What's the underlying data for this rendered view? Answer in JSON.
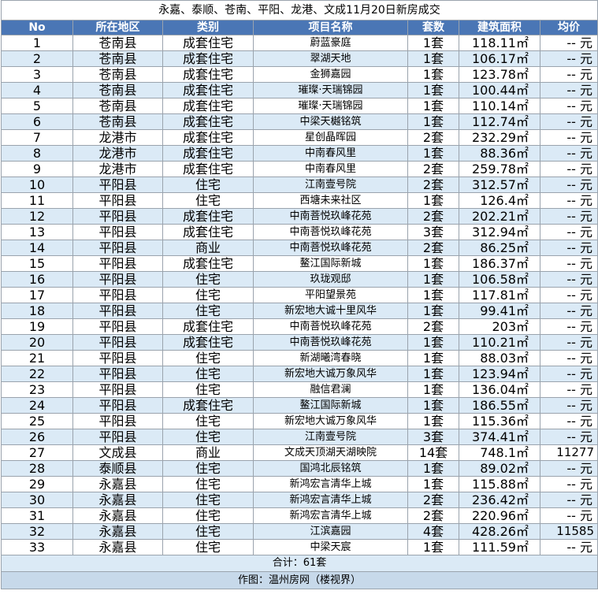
{
  "title": "永嘉、泰顺、苍南、平阳、龙港、文成11月20日新房成交",
  "headers": [
    "No",
    "所在地区",
    "类别",
    "项目名称",
    "套数",
    "建筑面积",
    "均价"
  ],
  "rows": [
    {
      "no": "1",
      "region": "苍南县",
      "type": "成套住宅",
      "name": "蔚蓝豪庭",
      "units": "1套",
      "area": "118.11㎡",
      "price": "-- 元"
    },
    {
      "no": "2",
      "region": "苍南县",
      "type": "成套住宅",
      "name": "翠湖天地",
      "units": "1套",
      "area": "106.17㎡",
      "price": "-- 元"
    },
    {
      "no": "3",
      "region": "苍南县",
      "type": "成套住宅",
      "name": "金狮嘉园",
      "units": "1套",
      "area": "123.78㎡",
      "price": "-- 元"
    },
    {
      "no": "4",
      "region": "苍南县",
      "type": "成套住宅",
      "name": "璀璨·天瑞锦园",
      "units": "1套",
      "area": "100.44㎡",
      "price": "-- 元"
    },
    {
      "no": "5",
      "region": "苍南县",
      "type": "成套住宅",
      "name": "璀璨·天瑞锦园",
      "units": "1套",
      "area": "110.14㎡",
      "price": "-- 元"
    },
    {
      "no": "6",
      "region": "苍南县",
      "type": "成套住宅",
      "name": "中梁天樾铭筑",
      "units": "1套",
      "area": "112.74㎡",
      "price": "-- 元"
    },
    {
      "no": "7",
      "region": "龙港市",
      "type": "成套住宅",
      "name": "星创晶晖园",
      "units": "2套",
      "area": "232.29㎡",
      "price": "-- 元"
    },
    {
      "no": "8",
      "region": "龙港市",
      "type": "成套住宅",
      "name": "中南春风里",
      "units": "1套",
      "area": "88.36㎡",
      "price": "-- 元"
    },
    {
      "no": "9",
      "region": "龙港市",
      "type": "成套住宅",
      "name": "中南春风里",
      "units": "2套",
      "area": "259.78㎡",
      "price": "-- 元"
    },
    {
      "no": "10",
      "region": "平阳县",
      "type": "住宅",
      "name": "江南壹号院",
      "units": "2套",
      "area": "312.57㎡",
      "price": "-- 元"
    },
    {
      "no": "11",
      "region": "平阳县",
      "type": "住宅",
      "name": "西塘未来社区",
      "units": "1套",
      "area": "126.4㎡",
      "price": "-- 元"
    },
    {
      "no": "12",
      "region": "平阳县",
      "type": "成套住宅",
      "name": "中南菩悦玖峰花苑",
      "units": "2套",
      "area": "202.21㎡",
      "price": "-- 元"
    },
    {
      "no": "13",
      "region": "平阳县",
      "type": "成套住宅",
      "name": "中南菩悦玖峰花苑",
      "units": "3套",
      "area": "312.94㎡",
      "price": "-- 元"
    },
    {
      "no": "14",
      "region": "平阳县",
      "type": "商业",
      "name": "中南菩悦玖峰花苑",
      "units": "2套",
      "area": "86.25㎡",
      "price": "-- 元"
    },
    {
      "no": "15",
      "region": "平阳县",
      "type": "成套住宅",
      "name": "鳌江国际新城",
      "units": "1套",
      "area": "186.37㎡",
      "price": "-- 元"
    },
    {
      "no": "16",
      "region": "平阳县",
      "type": "住宅",
      "name": "玖珑观邸",
      "units": "1套",
      "area": "106.58㎡",
      "price": "-- 元"
    },
    {
      "no": "17",
      "region": "平阳县",
      "type": "住宅",
      "name": "平阳望景苑",
      "units": "1套",
      "area": "117.81㎡",
      "price": "-- 元"
    },
    {
      "no": "18",
      "region": "平阳县",
      "type": "住宅",
      "name": "新宏地大诚十里风华",
      "units": "1套",
      "area": "99.41㎡",
      "price": "-- 元"
    },
    {
      "no": "19",
      "region": "平阳县",
      "type": "成套住宅",
      "name": "中南菩悦玖峰花苑",
      "units": "2套",
      "area": "203㎡",
      "price": "-- 元"
    },
    {
      "no": "20",
      "region": "平阳县",
      "type": "成套住宅",
      "name": "中南菩悦玖峰花苑",
      "units": "1套",
      "area": "110.21㎡",
      "price": "-- 元"
    },
    {
      "no": "21",
      "region": "平阳县",
      "type": "住宅",
      "name": "新湖曦湾春晓",
      "units": "1套",
      "area": "88.03㎡",
      "price": "-- 元"
    },
    {
      "no": "22",
      "region": "平阳县",
      "type": "住宅",
      "name": "新宏地大诚万象风华",
      "units": "1套",
      "area": "123.94㎡",
      "price": "-- 元"
    },
    {
      "no": "23",
      "region": "平阳县",
      "type": "住宅",
      "name": "融信君澜",
      "units": "1套",
      "area": "136.04㎡",
      "price": "-- 元"
    },
    {
      "no": "24",
      "region": "平阳县",
      "type": "成套住宅",
      "name": "鳌江国际新城",
      "units": "1套",
      "area": "186.55㎡",
      "price": "-- 元"
    },
    {
      "no": "25",
      "region": "平阳县",
      "type": "住宅",
      "name": "新宏地大诚万象风华",
      "units": "1套",
      "area": "115.36㎡",
      "price": "-- 元"
    },
    {
      "no": "26",
      "region": "平阳县",
      "type": "住宅",
      "name": "江南壹号院",
      "units": "3套",
      "area": "374.41㎡",
      "price": "-- 元"
    },
    {
      "no": "27",
      "region": "文成县",
      "type": "商业",
      "name": "文成天顶湖天湖映院",
      "units": "14套",
      "area": "748.1㎡",
      "price": "11277"
    },
    {
      "no": "28",
      "region": "泰顺县",
      "type": "住宅",
      "name": "国鸿北辰铭筑",
      "units": "1套",
      "area": "89.02㎡",
      "price": "-- 元"
    },
    {
      "no": "29",
      "region": "永嘉县",
      "type": "住宅",
      "name": "新鸿宏言清华上城",
      "units": "1套",
      "area": "115.88㎡",
      "price": "-- 元"
    },
    {
      "no": "30",
      "region": "永嘉县",
      "type": "住宅",
      "name": "新鸿宏言清华上城",
      "units": "2套",
      "area": "236.42㎡",
      "price": "-- 元"
    },
    {
      "no": "31",
      "region": "永嘉县",
      "type": "住宅",
      "name": "新鸿宏言清华上城",
      "units": "2套",
      "area": "220.96㎡",
      "price": "-- 元"
    },
    {
      "no": "32",
      "region": "永嘉县",
      "type": "住宅",
      "name": "江滨嘉园",
      "units": "4套",
      "area": "428.26㎡",
      "price": "11585"
    },
    {
      "no": "33",
      "region": "永嘉县",
      "type": "住宅",
      "name": "中梁天宸",
      "units": "1套",
      "area": "111.59㎡",
      "price": "-- 元"
    }
  ],
  "total": "合计：61套",
  "credit": "作图：温州房网（楼视界）"
}
